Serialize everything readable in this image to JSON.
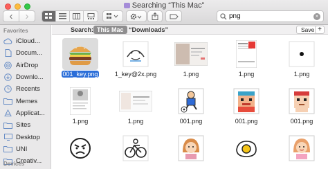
{
  "window": {
    "title": "Searching “This Mac”"
  },
  "toolbar": {
    "nav_back": "‹",
    "nav_fwd": "›",
    "view_icons": [
      "icon-view-icon",
      "list-view-icon",
      "column-view-icon",
      "gallery-view-icon"
    ],
    "group_icon": "group-icon",
    "action_icon": "gear-icon",
    "share_icon": "share-icon",
    "tag_icon": "tag-icon",
    "search": {
      "value": "png",
      "placeholder": "Search"
    }
  },
  "sidebar": {
    "favorites_heading": "Favorites",
    "items": [
      {
        "label": "iCloud...",
        "icon": "cloud-icon"
      },
      {
        "label": "Docum...",
        "icon": "document-icon"
      },
      {
        "label": "AirDrop",
        "icon": "airdrop-icon"
      },
      {
        "label": "Downlo...",
        "icon": "downloads-icon"
      },
      {
        "label": "Recents",
        "icon": "clock-icon"
      },
      {
        "label": "Memes",
        "icon": "folder-icon"
      },
      {
        "label": "Applicat...",
        "icon": "applications-icon"
      },
      {
        "label": "Sites",
        "icon": "folder-icon"
      },
      {
        "label": "Desktop",
        "icon": "desktop-icon"
      },
      {
        "label": "UNI",
        "icon": "folder-icon"
      },
      {
        "label": "Creativ...",
        "icon": "folder-icon"
      }
    ],
    "devices_heading": "Devices"
  },
  "scope": {
    "label": "Search:",
    "this_mac": "This Mac",
    "downloads": "“Downloads”",
    "save": "Save",
    "plus": "+"
  },
  "files": [
    {
      "name": "001_key.png",
      "selected": true,
      "thumb": "burger"
    },
    {
      "name": "1_key@2x.png",
      "selected": false,
      "thumb": "emoji-face"
    },
    {
      "name": "1.png",
      "selected": false,
      "thumb": "screenshot"
    },
    {
      "name": "1.png",
      "selected": false,
      "thumb": "document-red"
    },
    {
      "name": "1.png",
      "selected": false,
      "thumb": "dot"
    },
    {
      "name": "1.png",
      "selected": false,
      "thumb": "document-photo"
    },
    {
      "name": "1.png",
      "selected": false,
      "thumb": "screenshot-wide"
    },
    {
      "name": "001.png",
      "selected": false,
      "thumb": "soccer"
    },
    {
      "name": "001.png",
      "selected": false,
      "thumb": "pixel-face"
    },
    {
      "name": "001.png",
      "selected": false,
      "thumb": "pixel-head"
    },
    {
      "name": "",
      "selected": false,
      "thumb": "angry-face"
    },
    {
      "name": "",
      "selected": false,
      "thumb": "bike"
    },
    {
      "name": "",
      "selected": false,
      "thumb": "girl"
    },
    {
      "name": "",
      "selected": false,
      "thumb": "egg"
    },
    {
      "name": "",
      "selected": false,
      "thumb": "girl-pink"
    }
  ]
}
